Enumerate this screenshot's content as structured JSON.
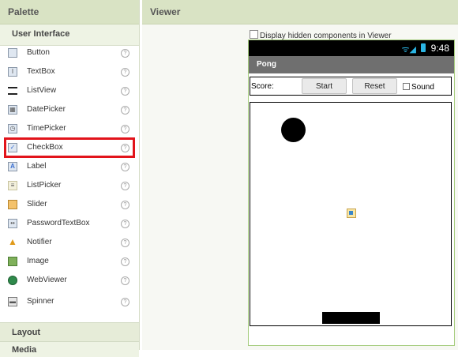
{
  "palette": {
    "title": "Palette",
    "section_ui": "User Interface",
    "items": [
      {
        "label": "Button",
        "icon": "button-icon"
      },
      {
        "label": "TextBox",
        "icon": "textbox-icon"
      },
      {
        "label": "ListView",
        "icon": "listview-icon"
      },
      {
        "label": "DatePicker",
        "icon": "datepicker-icon"
      },
      {
        "label": "TimePicker",
        "icon": "timepicker-icon"
      },
      {
        "label": "CheckBox",
        "icon": "checkbox-icon",
        "selected": true
      },
      {
        "label": "Label",
        "icon": "label-icon"
      },
      {
        "label": "ListPicker",
        "icon": "listpicker-icon"
      },
      {
        "label": "Slider",
        "icon": "slider-icon"
      },
      {
        "label": "PasswordTextBox",
        "icon": "passwordtextbox-icon"
      },
      {
        "label": "Notifier",
        "icon": "notifier-icon"
      },
      {
        "label": "Image",
        "icon": "image-icon"
      },
      {
        "label": "WebViewer",
        "icon": "webviewer-icon"
      },
      {
        "label": "Spinner",
        "icon": "spinner-icon"
      }
    ],
    "section_layout": "Layout",
    "section_media": "Media"
  },
  "viewer": {
    "title": "Viewer",
    "display_hidden": "Display hidden components in Viewer",
    "phone": {
      "time": "9:48",
      "screen_title": "Pong",
      "score_label": "Score:",
      "start_label": "Start",
      "reset_label": "Reset",
      "sound_label": "Sound"
    }
  },
  "colors": {
    "selection": "#e2141b",
    "panel_header": "#d9e3c4",
    "status_icons": "#2bb5e3"
  }
}
